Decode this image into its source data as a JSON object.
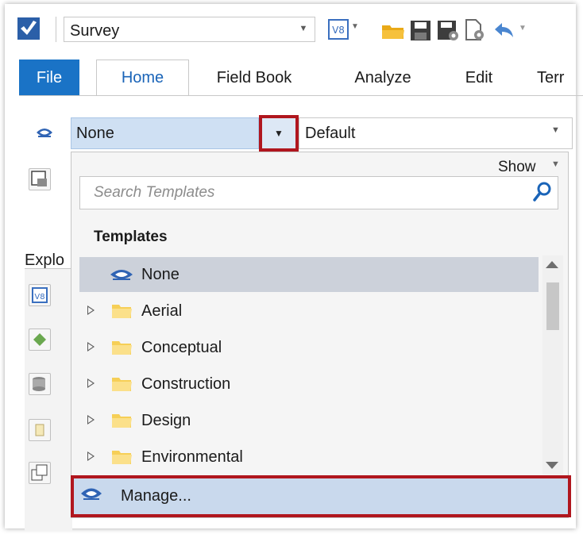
{
  "toolbar": {
    "workflow_value": "Survey",
    "icons": [
      "app-logo-icon",
      "v8-icon",
      "open-folder-icon",
      "save-icon",
      "save-settings-icon",
      "file-properties-icon",
      "undo-icon"
    ]
  },
  "ribbon": {
    "tabs": [
      {
        "label": "File",
        "active": false
      },
      {
        "label": "Home",
        "active": true
      },
      {
        "label": "Field Book",
        "active": false
      },
      {
        "label": "Analyze",
        "active": false
      },
      {
        "label": "Edit",
        "active": false
      },
      {
        "label": "Terr",
        "active": false
      }
    ]
  },
  "selectors": {
    "template_value": "None",
    "level_value": "Default"
  },
  "explorer": {
    "label": "Explo"
  },
  "dropdown": {
    "show_label": "Show",
    "search_placeholder": "Search Templates",
    "section_header": "Templates",
    "items": [
      {
        "label": "None",
        "type": "template",
        "selected": true
      },
      {
        "label": "Aerial",
        "type": "folder",
        "selected": false
      },
      {
        "label": "Conceptual",
        "type": "folder",
        "selected": false
      },
      {
        "label": "Construction",
        "type": "folder",
        "selected": false
      },
      {
        "label": "Design",
        "type": "folder",
        "selected": false
      },
      {
        "label": "Environmental",
        "type": "folder",
        "selected": false
      }
    ],
    "footer_action": "Manage..."
  },
  "colors": {
    "accent": "#1a73c6",
    "highlight_outline": "#b0161e",
    "selection": "#ccd1da",
    "input_selected": "#cfe0f3"
  }
}
